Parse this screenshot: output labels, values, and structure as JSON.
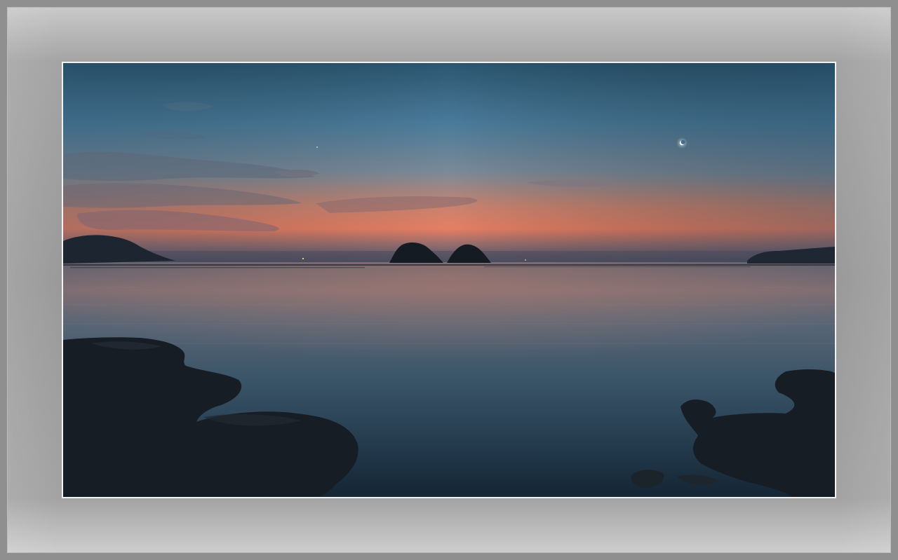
{
  "scene": {
    "subject": "sunset-seascape-twin-islets",
    "colors": {
      "frame": "#8f8f8f",
      "mat_light": "#cdcdcd",
      "mat_mid": "#9a9a9a",
      "photo_border": "#f2f2f2",
      "sky_top": "#2d5772",
      "sky_mid": "#4d7fa0",
      "sky_glow": "#e8806a",
      "sea": "#233749",
      "rock": "#141a20"
    }
  }
}
